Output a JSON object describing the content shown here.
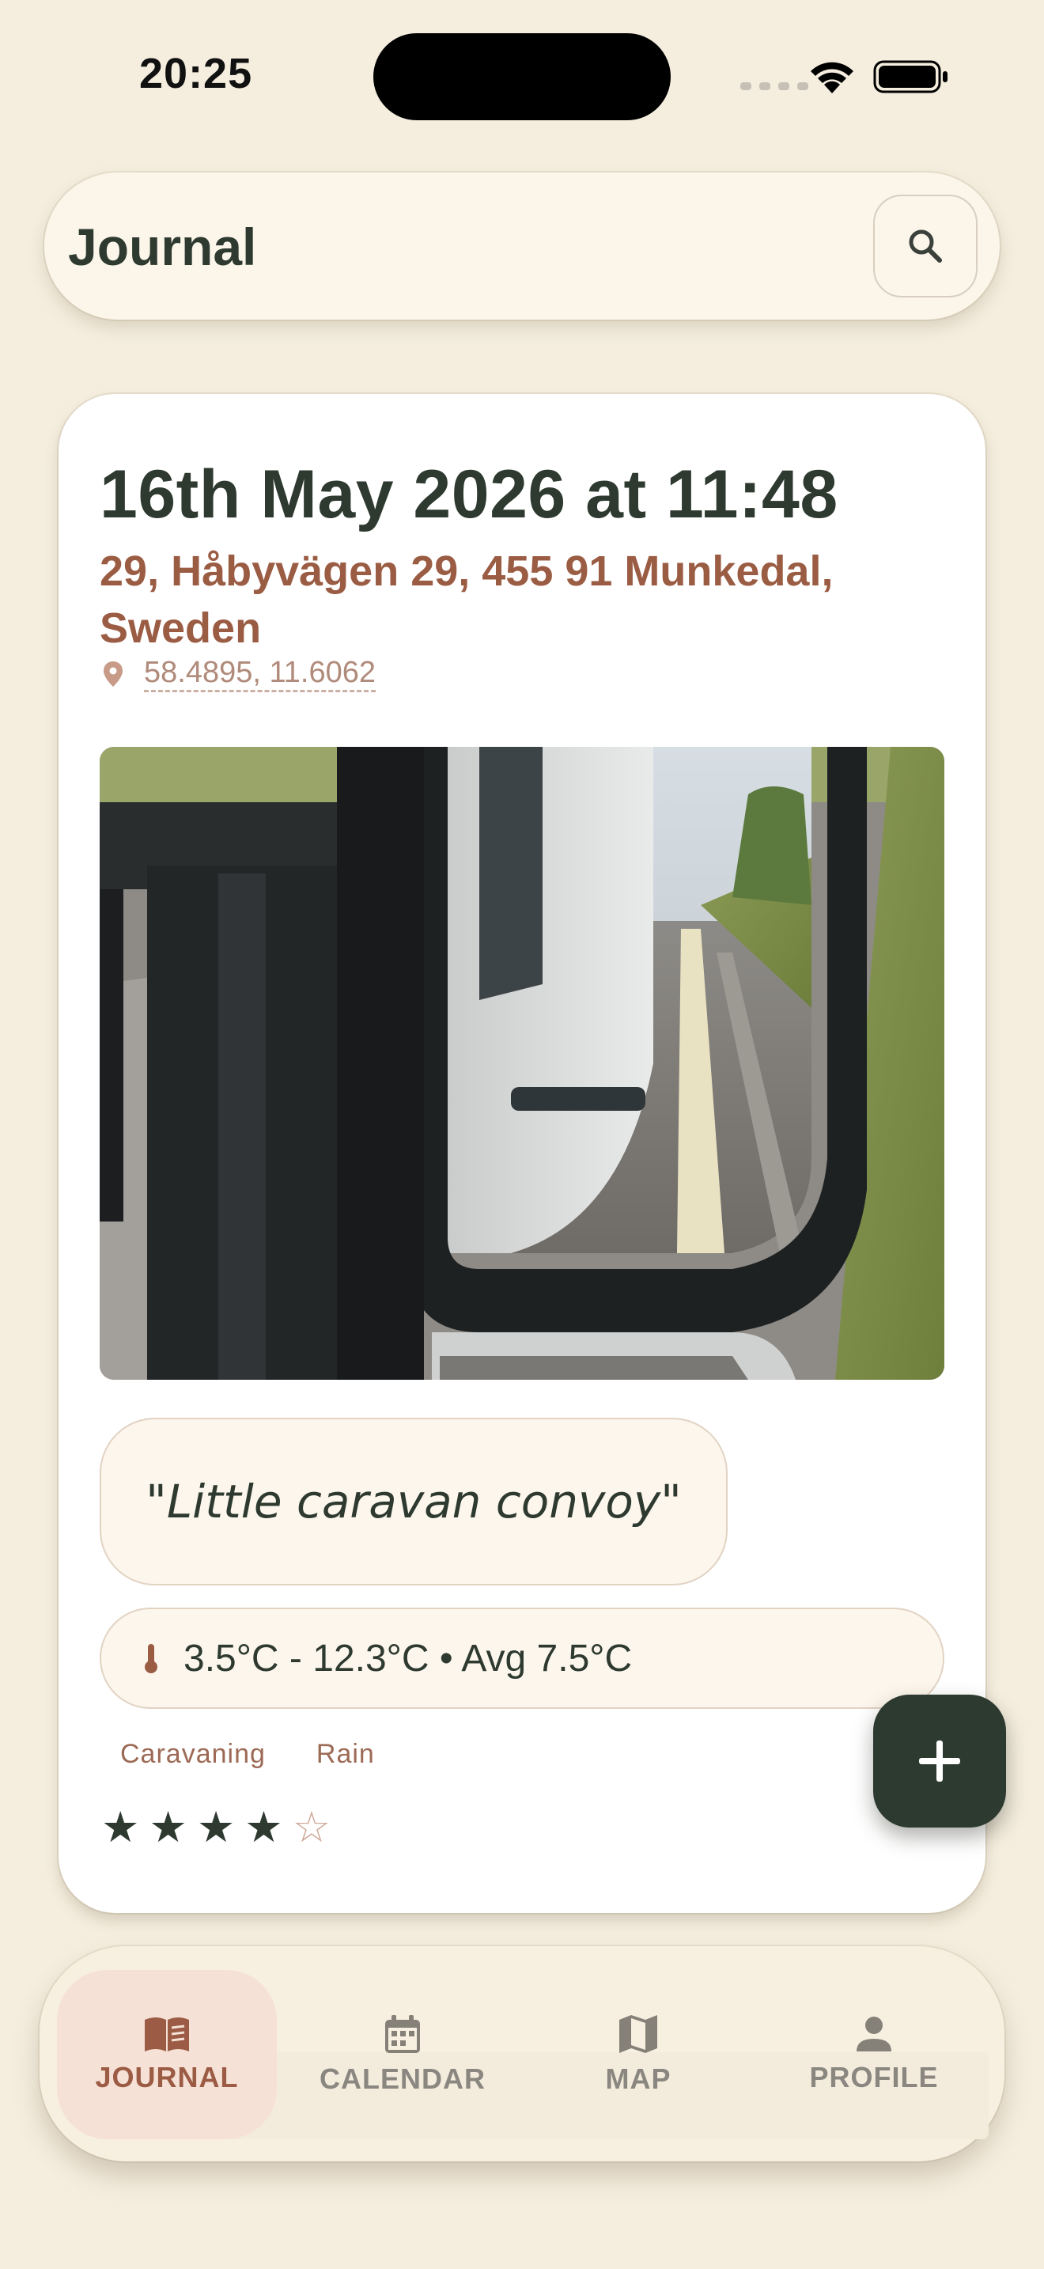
{
  "status_bar": {
    "time": "20:25"
  },
  "header": {
    "title": "Journal",
    "search_icon": "search-icon"
  },
  "entry": {
    "date": "16th May 2026 at 11:48",
    "address": "29, Håbyvägen 29, 455 91 Munkedal, Sweden",
    "coordinates": "58.4895, 11.6062",
    "photo_description": "Truck side mirror reflecting caravan on wet road",
    "quote": "\"Little caravan convoy\"",
    "weather": "3.5°C - 12.3°C • Avg 7.5°C",
    "tags": [
      "Caravaning",
      "Rain"
    ],
    "rating": 4,
    "rating_max": 5
  },
  "fab": {
    "icon": "plus-icon"
  },
  "nav": {
    "items": [
      {
        "label": "JOURNAL",
        "icon": "book-icon",
        "active": true
      },
      {
        "label": "CALENDAR",
        "icon": "calendar-icon",
        "active": false
      },
      {
        "label": "MAP",
        "icon": "map-icon",
        "active": false
      },
      {
        "label": "PROFILE",
        "icon": "person-icon",
        "active": false
      }
    ]
  },
  "colors": {
    "background": "#f5eedf",
    "primary_dark": "#2e3a30",
    "accent": "#9b5c44",
    "active_nav_bg": "#f6e1d6"
  }
}
